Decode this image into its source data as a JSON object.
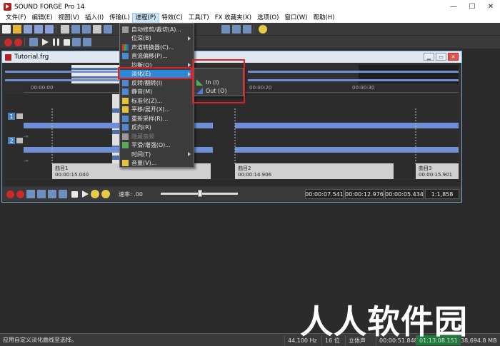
{
  "window": {
    "title": "SOUND FORGE Pro 14",
    "controls": [
      "—",
      "☐",
      "✕"
    ]
  },
  "menubar": {
    "items": [
      "文件(F)",
      "编辑(E)",
      "视图(V)",
      "插入(I)",
      "传输(L)",
      "进程(P)",
      "特效(C)",
      "工具(T)",
      "FX 收藏夹(X)",
      "选项(O)",
      "窗口(W)",
      "帮助(H)"
    ],
    "active_index": 5
  },
  "document": {
    "title": "Tutorial.frg",
    "ruler_ticks": [
      "00:00:00",
      "00:00:10",
      "00:00:20",
      "00:00:30"
    ],
    "channels": [
      {
        "number": "1",
        "inf_top": "-∞",
        "inf_bottom": "-∞"
      },
      {
        "number": "2",
        "inf_top": "-∞",
        "inf_bottom": "-∞"
      }
    ],
    "regions": [
      {
        "name": "曲目1",
        "time": "00:00:15.040"
      },
      {
        "name": "曲目2",
        "time": "00:00:14.906"
      },
      {
        "name": "曲目3",
        "time": "00:00:15.901"
      }
    ],
    "transport": {
      "rate_label": "速率: .00",
      "rate_value": 0.5,
      "times": [
        "00:00:07.541",
        "00:00:12.976",
        "00:00:05.434"
      ],
      "zoom": "1:1,858"
    }
  },
  "process_menu": {
    "items": [
      {
        "label": "自动修剪/裁切(A)...",
        "icon": "auto-trim-icon",
        "submenu": false,
        "disabled": false
      },
      {
        "label": "位深(B)",
        "icon": "",
        "submenu": true,
        "disabled": false
      },
      {
        "label": "声道转换器(C)...",
        "icon": "channel-converter-icon",
        "submenu": false,
        "disabled": false
      },
      {
        "label": "直流偏移(P)...",
        "icon": "dc-offset-icon",
        "submenu": false,
        "disabled": false
      },
      {
        "label": "均衡(Q)",
        "icon": "",
        "submenu": true,
        "disabled": false
      },
      {
        "label": "淡化(E)",
        "icon": "",
        "submenu": true,
        "disabled": false
      },
      {
        "label": "反转/翻转(I)",
        "icon": "invert-icon",
        "submenu": false,
        "disabled": false
      },
      {
        "label": "静音(M)",
        "icon": "mute-icon",
        "submenu": false,
        "disabled": false
      },
      {
        "label": "标准化(Z)...",
        "icon": "normalize-icon",
        "submenu": false,
        "disabled": false
      },
      {
        "label": "平移/展开(X)...",
        "icon": "pan-icon",
        "submenu": false,
        "disabled": false
      },
      {
        "label": "重新采样(R)...",
        "icon": "resample-icon",
        "submenu": false,
        "disabled": false
      },
      {
        "label": "反向(R)",
        "icon": "reverse-icon",
        "submenu": false,
        "disabled": false
      },
      {
        "label": "隐藏音频",
        "icon": "smart-icon",
        "submenu": false,
        "disabled": true
      },
      {
        "label": "平滑/增强(O)...",
        "icon": "smooth-icon",
        "submenu": false,
        "disabled": false
      },
      {
        "label": "时间(T)",
        "icon": "",
        "submenu": true,
        "disabled": false
      },
      {
        "label": "音量(V)...",
        "icon": "volume-icon",
        "submenu": false,
        "disabled": false
      }
    ],
    "highlight_index": 5
  },
  "fade_submenu": {
    "items": [
      {
        "label": "In (I)",
        "icon": "fade-in-icon"
      },
      {
        "label": "Out (O)",
        "icon": "fade-out-icon"
      }
    ]
  },
  "statusbar": {
    "message": "应用自定义淡化曲线至选择。",
    "sample_rate": "44,100 Hz",
    "bit_depth": "16 位",
    "channels": "立体声",
    "length": "00:00:51.848",
    "highlight_time": "01:13:08.151",
    "disk_space": "38,694.8 MB"
  },
  "watermark": {
    "text": "人人软件园"
  },
  "colors": {
    "accent": "#2e86d6",
    "waveform": "#6f8fd6",
    "highlight_time_bg": "#1e7a3a",
    "annotation_red": "#e02020"
  }
}
